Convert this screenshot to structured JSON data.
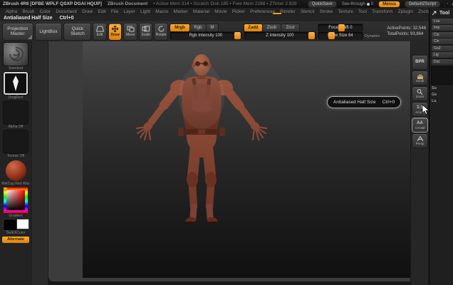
{
  "title_bar": {
    "app_title": "ZBrush 4R6 [DFBE WPLF QSXP DGAI HQUP]",
    "document_title": "ZBrush Document",
    "stats": "• Active Mem 314 • Scratch Disk 185 • Free Mem 2288 • ZTimer 2.928",
    "quicksave": "QuickSave",
    "see_through": "See-through",
    "see_through_value": "0",
    "menus": "Menus",
    "default_zscript": "DefaultZScript"
  },
  "menu": {
    "items": [
      "Alpha",
      "Brush",
      "Color",
      "Document",
      "Draw",
      "Edit",
      "File",
      "Layer",
      "Light",
      "Macro",
      "Marker",
      "Material",
      "Movie",
      "Picker",
      "Preferences",
      "Render",
      "Stencil",
      "Stroke",
      "Texture",
      "Tool",
      "Transform",
      "Zplugin",
      "Zscript"
    ]
  },
  "hint": {
    "label": "Antialiased Half Size",
    "shortcut": "Ctrl+0"
  },
  "toolbar": {
    "projection_master": "Projection Master",
    "lightbox": "LightBox",
    "quick_sketch": "Quick Sketch",
    "edit": "Edit",
    "draw": "Draw",
    "move": "Move",
    "scale": "Scale",
    "rotate": "Rotate",
    "mrgb": "Mrgb",
    "rgb": "Rgb",
    "m": "M",
    "zadd": "Zadd",
    "zsub": "Zsub",
    "zcut": "Zcut",
    "rgb_intensity": "Rgb Intensity 100",
    "z_intensity": "Z Intensity 100",
    "focal_shift": "Focal Shift 0",
    "draw_size": "Draw Size 64",
    "dynamic": "Dynamic",
    "active_points": "ActivePoints: 32,546",
    "total_points": "TotalPoints: 93,864"
  },
  "left_shelf": {
    "brush_label": "Standard",
    "stroke_label": "DragRect",
    "alpha_label": "Alpha Off",
    "texture_label": "Texture Off",
    "material_label": "MatCap Red Wax",
    "gradient_label": "Gradient",
    "switch_color_label": "SwitchColor",
    "alternate_label": "Alternate"
  },
  "right_shelf": {
    "buttons": [
      {
        "id": "bpr",
        "label": "BPR"
      },
      {
        "id": "scroll",
        "label": "Scroll"
      },
      {
        "id": "zoom",
        "label": "Zoom"
      },
      {
        "id": "actual",
        "label": "Actual"
      },
      {
        "id": "aahalf",
        "label": "AAHalf"
      },
      {
        "id": "persp",
        "label": "Persp"
      }
    ]
  },
  "tooltip": {
    "label": "Antialiased Half Size",
    "shortcut": "Ctrl+0"
  },
  "right_tray": {
    "header": "Tool",
    "clipped_buttons": [
      "Loa",
      "Imp",
      "Clo",
      "Cle",
      "GoZ",
      "Lig",
      "Doc"
    ],
    "section_labels": [
      "Su",
      "Ge",
      "La"
    ]
  },
  "canvas": {
    "model_description": "Sculpted male figure in A-pose wearing vest, red wax clay material"
  },
  "colors": {
    "accent": "#ff9c00",
    "material_red": "#a33d22"
  }
}
